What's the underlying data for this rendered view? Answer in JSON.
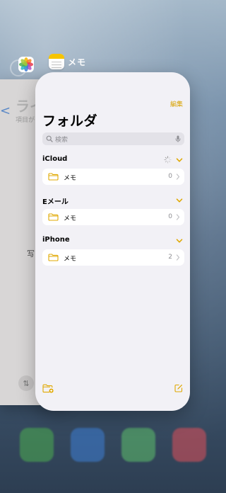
{
  "switcher": {
    "notes_app_label": "メモ"
  },
  "photos_card": {
    "title": "ライ",
    "subtitle": "項目があ",
    "back_glyph": "<",
    "partial_char": "写",
    "sort_glyph": "⇅"
  },
  "notes_card": {
    "edit_label": "編集",
    "title": "フォルダ",
    "search": {
      "placeholder": "検索"
    },
    "sections": [
      {
        "header": "iCloud",
        "syncing": true,
        "folder": {
          "name": "メモ",
          "count": "0"
        }
      },
      {
        "header": "Eメール",
        "syncing": false,
        "folder": {
          "name": "メモ",
          "count": "0"
        }
      },
      {
        "header": "iPhone",
        "syncing": false,
        "folder": {
          "name": "メモ",
          "count": "2"
        }
      }
    ]
  },
  "colors": {
    "accent": "#e0a800",
    "card_bg": "#f2f1f6",
    "row_bg": "#ffffff",
    "secondary_text": "#8e8e93"
  }
}
